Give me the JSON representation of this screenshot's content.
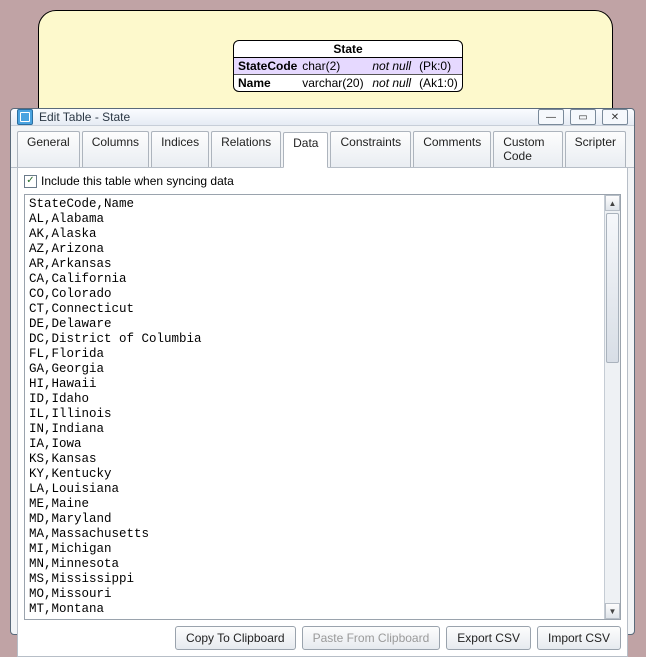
{
  "schema": {
    "title": "State",
    "rows": [
      {
        "col": "StateCode",
        "type": "char(2)",
        "null": "not null",
        "key": "(Pk:0)"
      },
      {
        "col": "Name",
        "type": "varchar(20)",
        "null": "not null",
        "key": "(Ak1:0)"
      }
    ]
  },
  "window": {
    "title": "Edit Table - State"
  },
  "tabs": {
    "items": [
      "General",
      "Columns",
      "Indices",
      "Relations",
      "Data",
      "Constraints",
      "Comments",
      "Custom Code",
      "Scripter"
    ],
    "active": 4
  },
  "checkbox": {
    "label": "Include this table when syncing data",
    "checked": true
  },
  "csv": {
    "header": "StateCode,Name",
    "rows": [
      "AL,Alabama",
      "AK,Alaska",
      "AZ,Arizona",
      "AR,Arkansas",
      "CA,California",
      "CO,Colorado",
      "CT,Connecticut",
      "DE,Delaware",
      "DC,District of Columbia",
      "FL,Florida",
      "GA,Georgia",
      "HI,Hawaii",
      "ID,Idaho",
      "IL,Illinois",
      "IN,Indiana",
      "IA,Iowa",
      "KS,Kansas",
      "KY,Kentucky",
      "LA,Louisiana",
      "ME,Maine",
      "MD,Maryland",
      "MA,Massachusetts",
      "MI,Michigan",
      "MN,Minnesota",
      "MS,Mississippi",
      "MO,Missouri",
      "MT,Montana"
    ]
  },
  "buttons": {
    "copy": "Copy To Clipboard",
    "paste": "Paste From Clipboard",
    "export": "Export CSV",
    "import": "Import CSV"
  },
  "winctrl": {
    "min": "—",
    "max": "▭",
    "close": "✕"
  }
}
